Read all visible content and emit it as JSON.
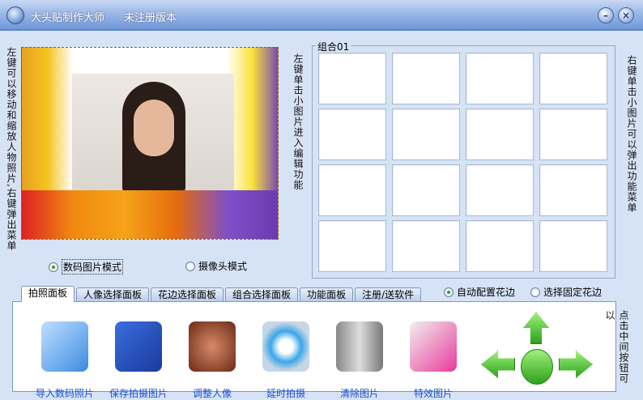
{
  "window": {
    "title": "大头贴制作大师",
    "subtitle": "未注册版本",
    "minimize": "–",
    "close": "×"
  },
  "hints": {
    "left": "左键可以移动和缩放人物照片,右键弹出菜单",
    "middle": "左键单击小图片进入编辑功能",
    "right": "右键单击小图片可以弹出功能菜单",
    "bottom_right": "点击中间按钮可以"
  },
  "mode": {
    "digital": "数码图片模式",
    "camera": "摄像头模式",
    "selected": "digital"
  },
  "group": {
    "label": "组合01",
    "cells": 16
  },
  "tabs": [
    "拍照面板",
    "人像选择面板",
    "花边选择面板",
    "组合选择面板",
    "功能面板",
    "注册/送软件"
  ],
  "border_mode": {
    "auto": "自动配置花边",
    "fixed": "选择固定花边",
    "selected": "auto"
  },
  "tools": [
    {
      "label": "导入数码照片",
      "icon": "camera-photo-icon"
    },
    {
      "label": "保存拍摄图片",
      "icon": "floppy-disk-icon"
    },
    {
      "label": "调整人像",
      "icon": "portrait-icon"
    },
    {
      "label": "延时拍摄",
      "icon": "compass-icon"
    },
    {
      "label": "清除图片",
      "icon": "trash-bin-icon"
    },
    {
      "label": "特效图片",
      "icon": "effects-jar-icon"
    }
  ]
}
